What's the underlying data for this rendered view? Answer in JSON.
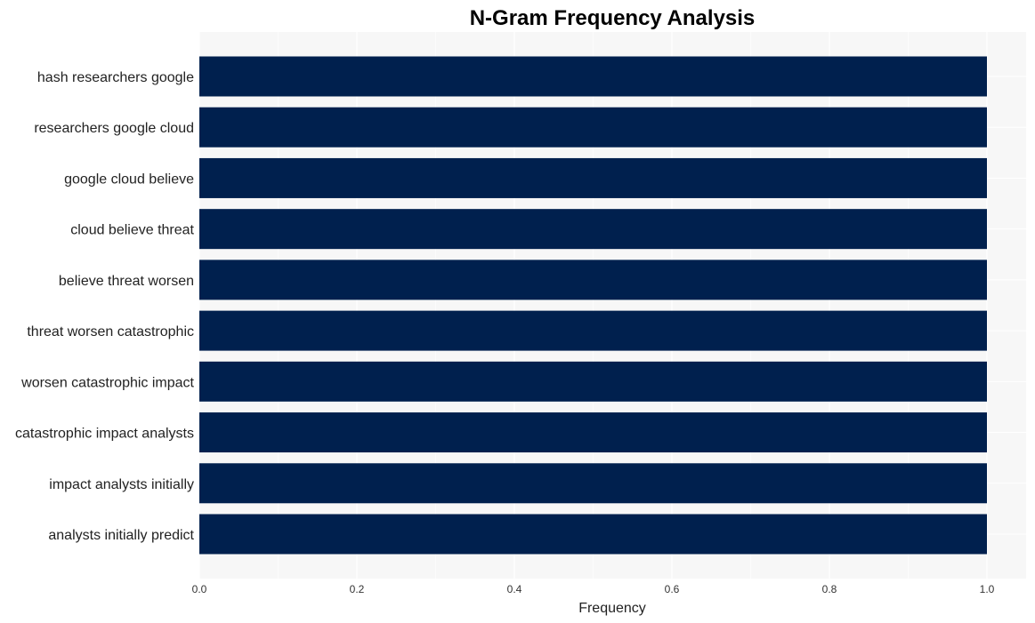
{
  "chart_data": {
    "type": "bar",
    "orientation": "horizontal",
    "title": "N-Gram Frequency Analysis",
    "xlabel": "Frequency",
    "ylabel": "",
    "xlim": [
      0,
      1.05
    ],
    "xticks": [
      0.0,
      0.2,
      0.4,
      0.6,
      0.8,
      1.0
    ],
    "xtick_labels": [
      "0.0",
      "0.2",
      "0.4",
      "0.6",
      "0.8",
      "1.0"
    ],
    "grid": true,
    "bar_color": "#00204e",
    "categories": [
      "hash researchers google",
      "researchers google cloud",
      "google cloud believe",
      "cloud believe threat",
      "believe threat worsen",
      "threat worsen catastrophic",
      "worsen catastrophic impact",
      "catastrophic impact analysts",
      "impact analysts initially",
      "analysts initially predict"
    ],
    "values": [
      1,
      1,
      1,
      1,
      1,
      1,
      1,
      1,
      1,
      1
    ]
  }
}
